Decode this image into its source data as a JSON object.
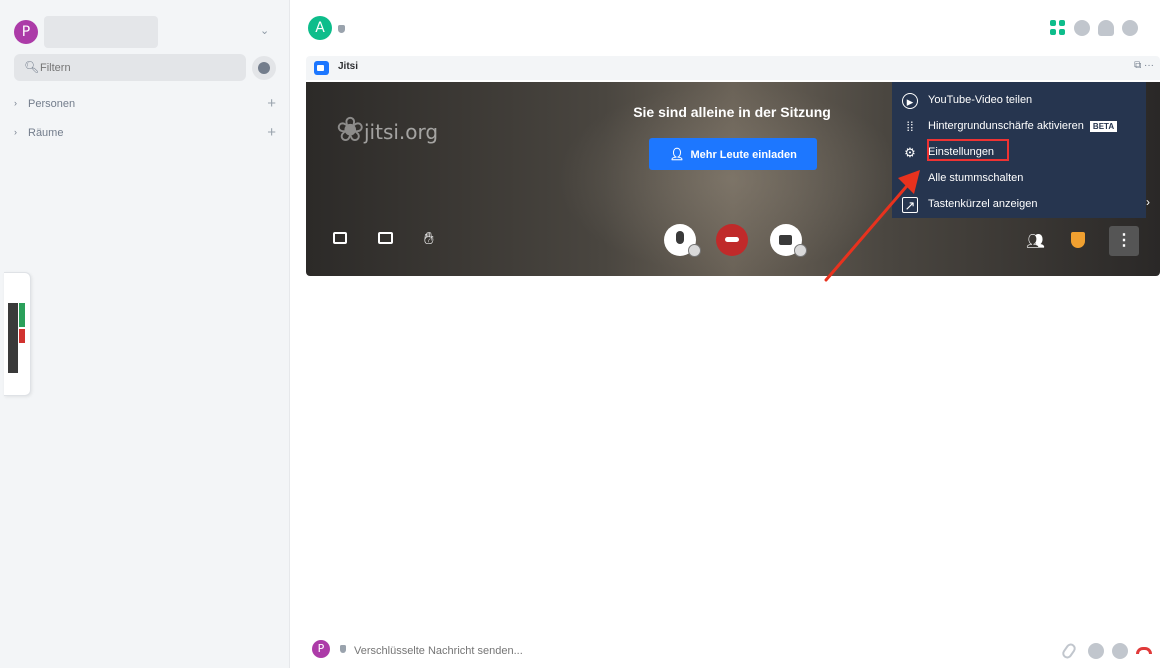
{
  "sidebar": {
    "user_avatar_letter": "P",
    "filter_placeholder": "Filtern",
    "sections": [
      {
        "label": "Personen"
      },
      {
        "label": "Räume"
      }
    ]
  },
  "room": {
    "avatar_letter": "A"
  },
  "widget": {
    "title": "Jitsi",
    "actions": "⧉ ···"
  },
  "call": {
    "logo_text": "jitsi.org",
    "alone_message": "Sie sind alleine in der Sitzung",
    "invite_label": "Mehr Leute einladen"
  },
  "menu": {
    "items": [
      {
        "label": "YouTube-Video teilen",
        "icon": "play-circle-icon"
      },
      {
        "label": "Hintergrundunschärfe aktivieren",
        "icon": "blur-icon",
        "badge": "BETA"
      },
      {
        "label": "Einstellungen",
        "icon": "gear-icon"
      },
      {
        "label": "Alle stummschalten",
        "icon": "none"
      },
      {
        "label": "Tastenkürzel anzeigen",
        "icon": "external-square-icon"
      }
    ]
  },
  "composer": {
    "avatar_letter": "P",
    "placeholder": "Verschlüsselte Nachricht senden..."
  },
  "colors": {
    "accent": "#0dbd8b",
    "jitsi_blue": "#1d77ff",
    "menu_bg": "#26354f",
    "hangup_red": "#c02a2a",
    "highlight_red": "#e33333"
  }
}
